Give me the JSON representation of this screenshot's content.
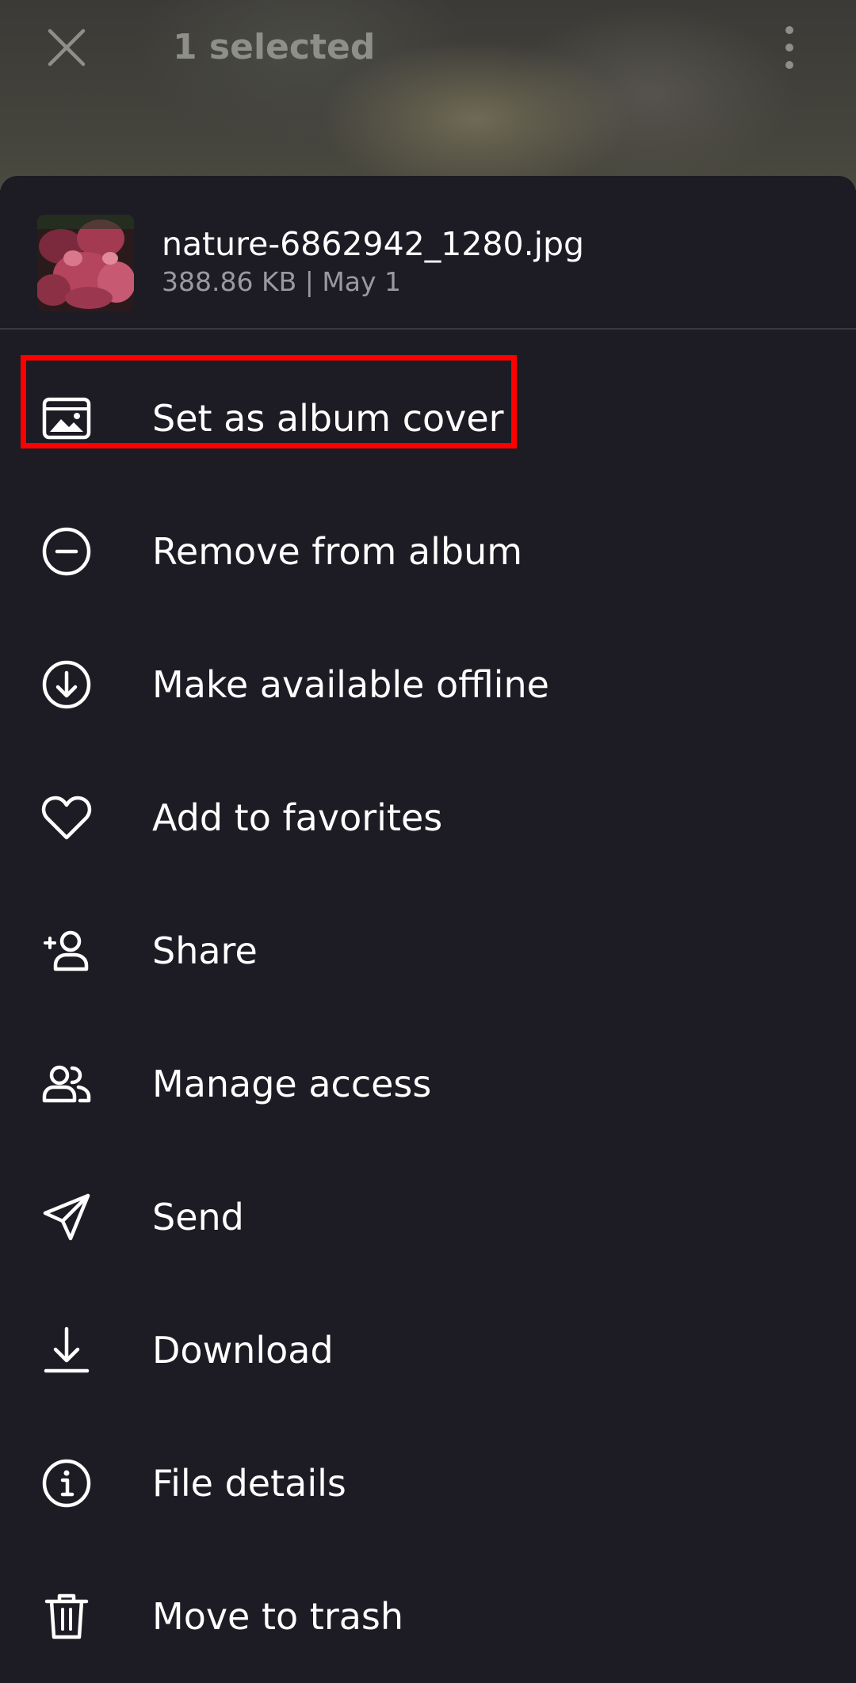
{
  "topbar": {
    "title": "1 selected",
    "close_icon": "close-icon",
    "more_icon": "more-vertical-icon"
  },
  "file": {
    "name": "nature-6862942_1280.jpg",
    "meta": "388.86 KB | May 1"
  },
  "menu": {
    "items": [
      {
        "label": "Set as album cover",
        "icon": "image-icon"
      },
      {
        "label": "Remove from album",
        "icon": "minus-circle-icon"
      },
      {
        "label": "Make available offline",
        "icon": "download-circle-icon"
      },
      {
        "label": "Add to favorites",
        "icon": "heart-icon"
      },
      {
        "label": "Share",
        "icon": "person-add-icon"
      },
      {
        "label": "Manage access",
        "icon": "people-icon"
      },
      {
        "label": "Send",
        "icon": "send-icon"
      },
      {
        "label": "Download",
        "icon": "download-icon"
      },
      {
        "label": "File details",
        "icon": "info-icon"
      },
      {
        "label": "Move to trash",
        "icon": "trash-icon"
      }
    ]
  },
  "colors": {
    "sheet_background": "#1d1c24",
    "text_primary": "#ffffff",
    "text_secondary": "#9a99a3",
    "highlight": "#ff0000"
  }
}
